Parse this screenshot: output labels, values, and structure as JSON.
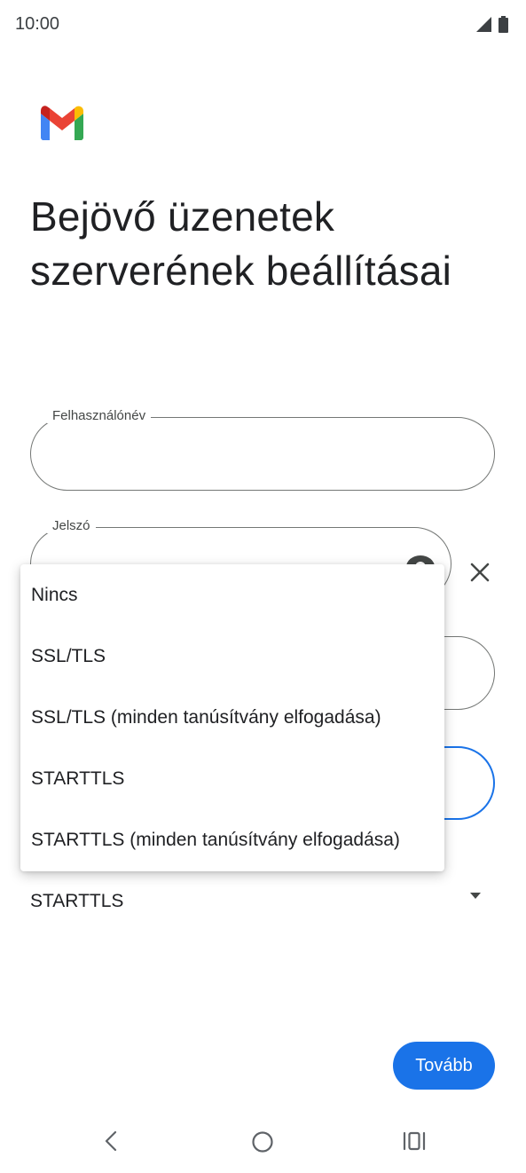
{
  "status_bar": {
    "time": "10:00",
    "icons": [
      "cellular-signal-icon",
      "battery-icon"
    ]
  },
  "header": {
    "logo": "gmail-logo",
    "title": "Bejövő üzenetek szerverének beállításai"
  },
  "form": {
    "username": {
      "label": "Felhasználónév",
      "value": ""
    },
    "password": {
      "label": "Jelszó",
      "value": ""
    },
    "security_type": {
      "selected": "STARTTLS"
    }
  },
  "dropdown": {
    "options": [
      "Nincs",
      "SSL/TLS",
      "SSL/TLS (minden tanúsítvány elfogadása)",
      "STARTTLS",
      "STARTTLS (minden tanúsítvány elfogadása)"
    ]
  },
  "actions": {
    "next_label": "Tovább"
  },
  "colors": {
    "accent": "#1a73e8",
    "outline": "#747775"
  }
}
